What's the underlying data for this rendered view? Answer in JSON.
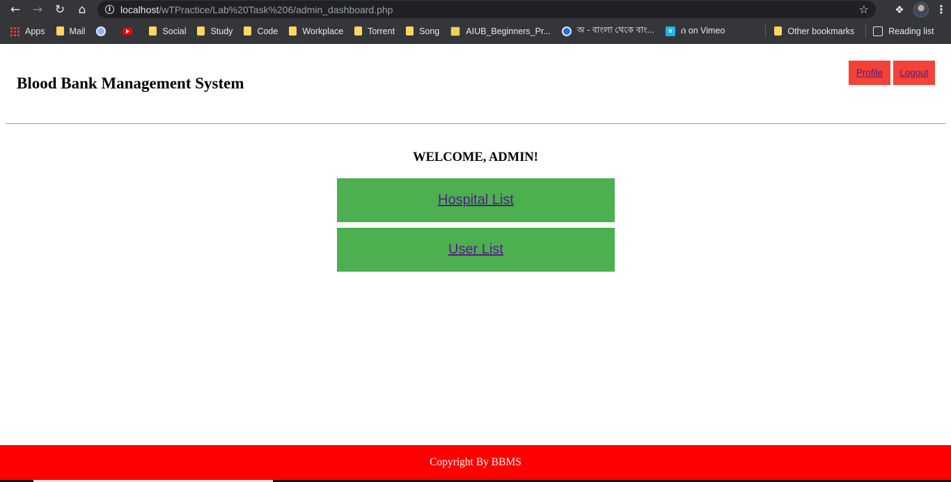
{
  "browser": {
    "url_host": "localhost",
    "url_path": "/wTPractice/Lab%20Task%206/admin_dashboard.php",
    "bookmarks": [
      {
        "label": "Apps",
        "icon": "apps-icon"
      },
      {
        "label": "Mail",
        "icon": "folder-icon"
      },
      {
        "label": "",
        "icon": "shield-icon"
      },
      {
        "label": "",
        "icon": "youtube-icon"
      },
      {
        "label": "Social",
        "icon": "folder-icon"
      },
      {
        "label": "Study",
        "icon": "folder-icon"
      },
      {
        "label": "Code",
        "icon": "folder-icon"
      },
      {
        "label": "Workplace",
        "icon": "folder-icon"
      },
      {
        "label": "Torrent",
        "icon": "folder-icon"
      },
      {
        "label": "Song",
        "icon": "folder-icon"
      },
      {
        "label": "AIUB_Beginners_Pr...",
        "icon": "aiub-icon"
      },
      {
        "label": "অ - বাংলা থেকে বাং...",
        "icon": "bangla-icon"
      },
      {
        "label": "ሰ on Vimeo",
        "icon": "vimeo-icon"
      }
    ],
    "other_bookmarks": "Other bookmarks",
    "reading_list": "Reading list"
  },
  "header": {
    "title": "Blood Bank Management System",
    "profile_label": "Profile",
    "logout_label": "Logout"
  },
  "main": {
    "welcome": "WELCOME, ADMIN!",
    "links": [
      {
        "label": "Hospital List"
      },
      {
        "label": "User List"
      }
    ]
  },
  "footer": {
    "text": "Copyright By BBMS"
  },
  "colors": {
    "header_button": "#f44336",
    "menu_card": "#4caf50",
    "footer": "#ff0000",
    "link": "#551a8b"
  }
}
